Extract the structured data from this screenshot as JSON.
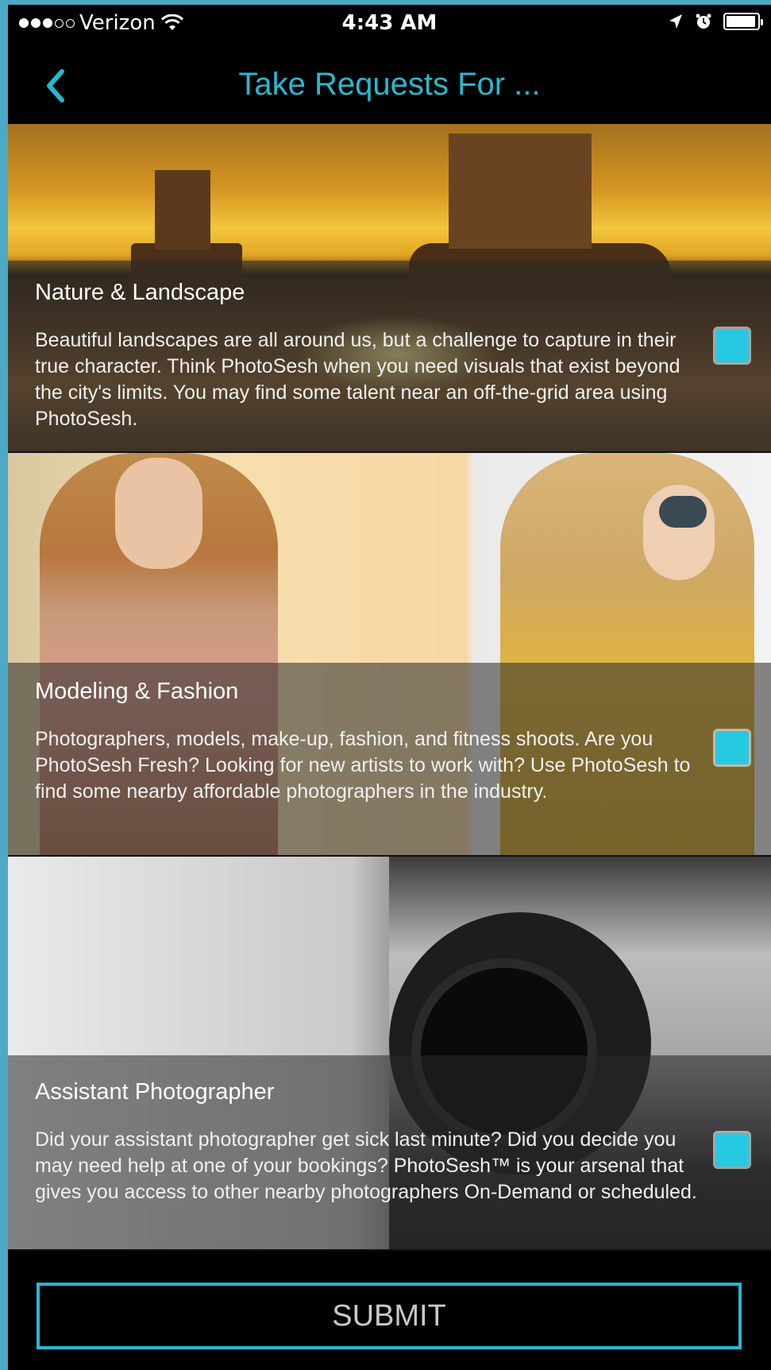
{
  "status_bar": {
    "carrier": "Verizon",
    "time": "4:43 AM",
    "signal_bars_filled": 3,
    "signal_bars_total": 5,
    "battery_level": 0.95,
    "icons": [
      "wifi-icon",
      "location-icon",
      "alarm-icon",
      "battery-icon"
    ]
  },
  "nav": {
    "title": "Take Requests For ...",
    "back_icon": "chevron-left-icon"
  },
  "categories": [
    {
      "title": "Nature & Landscape",
      "description": "Beautiful landscapes are all around us, but a challenge to capture in their true character. Think PhotoSesh when you need visuals that exist beyond the city's limits. You may find some talent near an off-the-grid area using PhotoSesh.",
      "checked": true
    },
    {
      "title": "Modeling & Fashion",
      "description": "Photographers, models, make-up, fashion, and fitness shoots. Are you PhotoSesh Fresh? Looking for new artists to work with? Use PhotoSesh to find some nearby affordable photographers in the industry.",
      "checked": true
    },
    {
      "title": "Assistant Photographer",
      "description": "Did your assistant photographer get sick last minute?  Did you decide you may need help at one of your bookings? PhotoSesh™ is your arsenal that gives you access to other nearby photographers On-Demand or scheduled.",
      "checked": true
    }
  ],
  "submit_label": "SUBMIT",
  "colors": {
    "accent": "#27b9cf",
    "checkbox": "#27c9e2",
    "background": "#000000",
    "frame": "#4ea9c4"
  }
}
